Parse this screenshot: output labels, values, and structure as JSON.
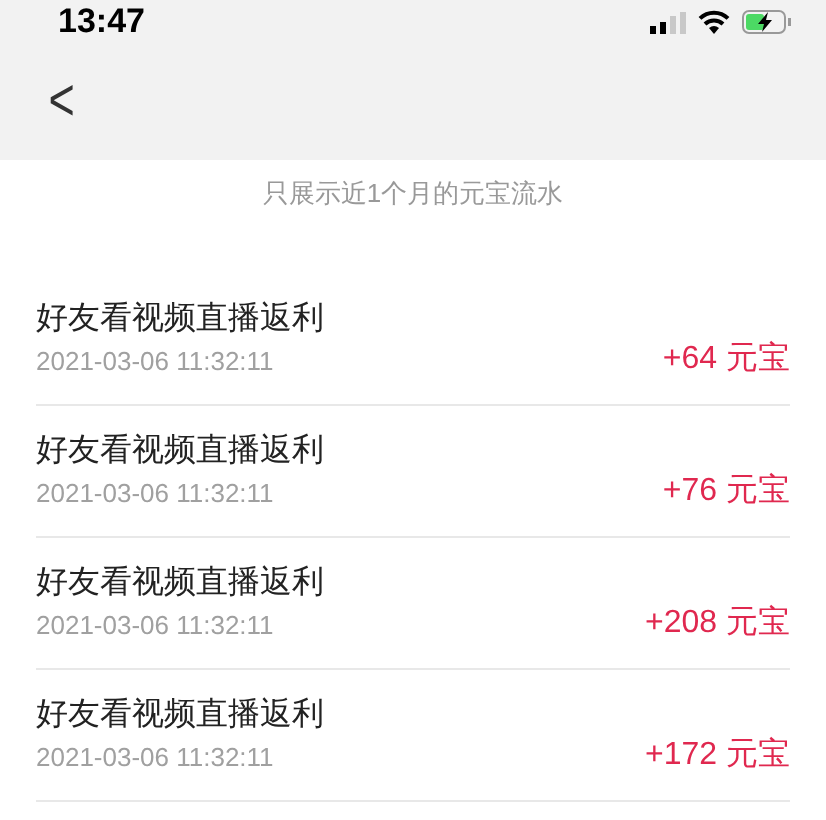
{
  "status_bar": {
    "time": "13:47"
  },
  "nav": {
    "back": "<"
  },
  "notice": "只展示近1个月的元宝流水",
  "records": [
    {
      "title": "好友看视频直播返利",
      "time": "2021-03-06 11:32:11",
      "amount": "+64 元宝"
    },
    {
      "title": "好友看视频直播返利",
      "time": "2021-03-06 11:32:11",
      "amount": "+76 元宝"
    },
    {
      "title": "好友看视频直播返利",
      "time": "2021-03-06 11:32:11",
      "amount": "+208 元宝"
    },
    {
      "title": "好友看视频直播返利",
      "time": "2021-03-06 11:32:11",
      "amount": "+172 元宝"
    }
  ]
}
